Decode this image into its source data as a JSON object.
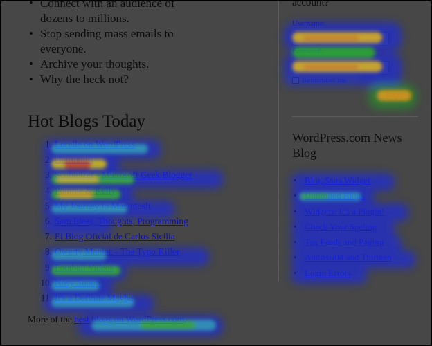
{
  "bullets": [
    {
      "line1": "Connect with an audience of",
      "line2": "dozens to millions."
    },
    {
      "line1": "Stop sending mass emails to",
      "line2": "everyone."
    },
    {
      "line1": "Archive your thoughts.",
      "line2": ""
    },
    {
      "line1": "Why the heck not?",
      "line2": ""
    }
  ],
  "hot_blogs": {
    "title": "Hot Blogs Today",
    "items": [
      {
        "num": "1.",
        "label": "Lorelle on WordPress"
      },
      {
        "num": "2.",
        "label": "churumuri"
      },
      {
        "num": "3.",
        "label": "Scobleizer - Microsoft Geek Blogger"
      },
      {
        "num": "4.",
        "label": "Pomme & Kelly"
      },
      {
        "num": "5.",
        "label": "My Journey to Macintosh"
      },
      {
        "num": "6.",
        "label": "Sam Ideas, Thoughts, Programming"
      },
      {
        "num": "7.",
        "label": "El Blog Oficial de Carlos Sicilia"
      },
      {
        "num": "8.",
        "label": "Qwerty Maniac - The Typo Killer"
      },
      {
        "num": "9.",
        "label": "Football Videos"
      },
      {
        "num": "10.",
        "label": "Nosy Snoop"
      },
      {
        "num": "11.",
        "label": "It's a Definite Maybe"
      }
    ],
    "more_prefix": "More of the ",
    "more_link": "best blogs on WordPress.com",
    "more_suffix": "."
  },
  "login": {
    "heading": "account?",
    "username_label": "Username:",
    "password_label": "Password:",
    "username_value": "",
    "password_value": "",
    "remember_label": "Remember me",
    "button_label": "Login »"
  },
  "news": {
    "title": "WordPress.com News Blog",
    "items": [
      "Blog Stats Widget",
      "Unlimited Blogs",
      "Widgets: It's a Plugin!",
      "Check Your Speling",
      "Tag Feeds and Paging",
      "Andreas04 and Thirteen",
      "Login Errors"
    ]
  },
  "colors": {
    "background": "#474747",
    "link": "#0a0cc8",
    "text": "#0e0e0e"
  },
  "heatmap": {
    "palette": [
      "blue",
      "cyan",
      "green",
      "yellow",
      "orange",
      "red"
    ]
  }
}
